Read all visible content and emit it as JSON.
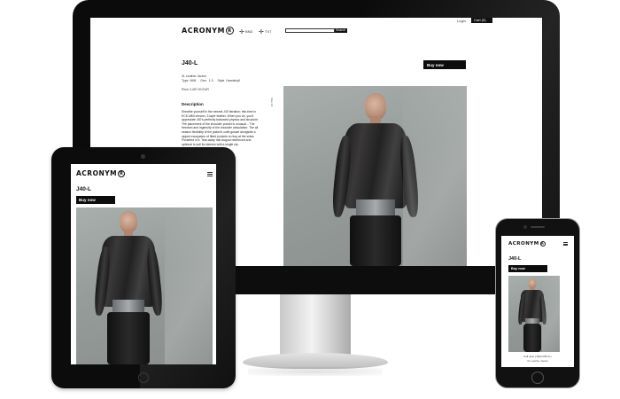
{
  "brand": "ACRONYM",
  "brand_mark": "R",
  "product": {
    "code": "J40-L",
    "buy_label": "Buy now",
    "spec_line1": "3L Leather Jacket",
    "spec_type_label": "Type",
    "spec_type_value": "MMI",
    "spec_gen_label": "Gen.",
    "spec_gen_value": "1.0",
    "spec_style_label": "Style",
    "spec_style_value": "Handshyfl",
    "price": "Price 2,497.00 EUR",
    "description_heading": "Description",
    "description_text": "Sheathe yourself in the newest J40 Iteration; this time in ECK-MMI version, 3 layer leather. When you do, you'll appreciate J40's perfectly balanced physics and structure. The placement of the shoulder pocket is unusual... The freedom and ingenuity of the shoulder articulation. The all season flexibility of the jacket's cuffs gusset alongside a zipped ecosystem of fitted pockets on tray at the sides. Pocketed in it. Tear-away rain dugout reinforced and optional to pull its sleeves with a single zip.",
    "mobile_caption": "Full view ( With P35-S )",
    "mobile_caption2": "3L Leather Jacket"
  },
  "desktop_nav": {
    "item1": "BND",
    "item2": "TXT",
    "search_button": "Search",
    "login": "Login",
    "cart": "Cart (0)"
  },
  "desktop_side_label": "Size: M"
}
